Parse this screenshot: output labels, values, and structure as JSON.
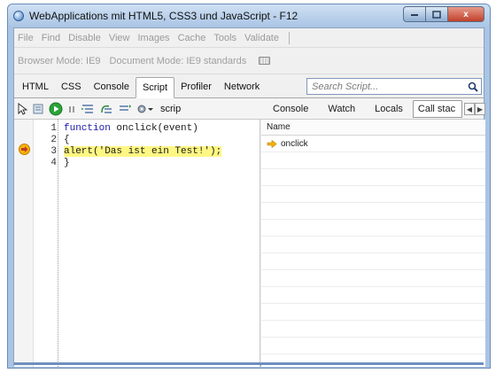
{
  "window": {
    "title": "WebApplications mit HTML5, CSS3 und JavaScript - F12",
    "controls": {
      "minimize": "",
      "maximize": "",
      "close": "x"
    }
  },
  "menubar": {
    "items": [
      "File",
      "Find",
      "Disable",
      "View",
      "Images",
      "Cache",
      "Tools",
      "Validate"
    ]
  },
  "modebar": {
    "browser_mode": "Browser Mode: IE9",
    "document_mode": "Document Mode: IE9 standards"
  },
  "tabs": {
    "items": [
      "HTML",
      "CSS",
      "Console",
      "Script",
      "Profiler",
      "Network"
    ],
    "active": "Script"
  },
  "search": {
    "placeholder": "Search Script..."
  },
  "script_toolbar": {
    "script_selector": "scrip",
    "panel_tabs": [
      "Console",
      "Watch",
      "Locals",
      "Call stac"
    ],
    "active_panel_tab": "Call stac"
  },
  "editor": {
    "lines": [
      {
        "num": "1",
        "kw": "function ",
        "rest": "onclick(event)"
      },
      {
        "num": "2",
        "rest": "{"
      },
      {
        "num": "3",
        "rest": "alert('Das ist ein Test!');",
        "current": true
      },
      {
        "num": "4",
        "rest": "}"
      }
    ]
  },
  "callstack": {
    "header": "Name",
    "rows": [
      {
        "name": "onclick"
      }
    ]
  },
  "colors": {
    "current_line_highlight": "#fff783",
    "breakpoint_arrow": "#f5b400",
    "run_button": "#2aa33a",
    "keyword": "#1a1aa8"
  },
  "icons": [
    "select-element-icon",
    "breakpoint-list-icon",
    "start-debugging-icon",
    "pause-icon",
    "step-into-icon",
    "step-over-icon",
    "step-out-icon",
    "settings-icon",
    "search-icon",
    "current-statement-arrow-icon"
  ]
}
